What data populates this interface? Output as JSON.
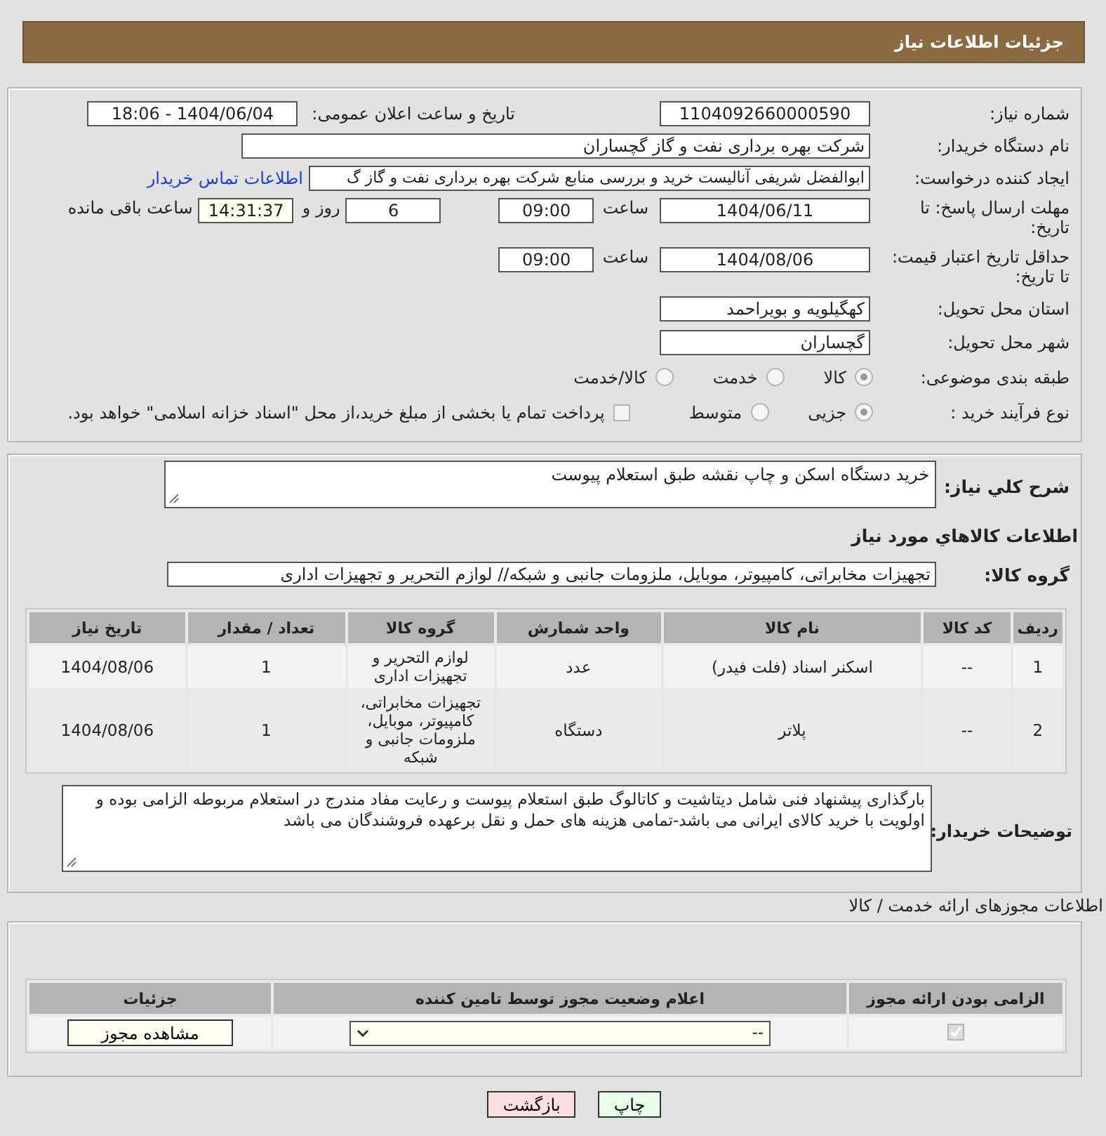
{
  "header": {
    "title": "جزئیات اطلاعات نیاز"
  },
  "details": {
    "need_number": {
      "label": "شماره نیاز:",
      "value": "1104092660000590"
    },
    "announce": {
      "label": "تاریخ و ساعت اعلان عمومی:",
      "value": "1404/06/04 - 18:06"
    },
    "buyer": {
      "label": "نام دستگاه خریدار:",
      "value": "شرکت بهره برداری نفت و گاز گچساران"
    },
    "creator": {
      "label": "ایجاد کننده درخواست:",
      "value": "ابوالفضل شریفی آنالیست خرید و بررسی منابع شرکت بهره برداری نفت و گاز گ",
      "link": "اطلاعات تماس خریدار"
    },
    "deadline": {
      "label": "مهلت ارسال پاسخ: تا تاریخ:",
      "date": "1404/06/11",
      "time_label": "ساعت",
      "time": "09:00",
      "days": "6",
      "days_label": "روز و",
      "remaining": "14:31:37",
      "remaining_label": "ساعت باقی مانده"
    },
    "validity": {
      "label": "حداقل تاریخ اعتبار قیمت: تا تاریخ:",
      "date": "1404/08/06",
      "time_label": "ساعت",
      "time": "09:00"
    },
    "province": {
      "label": "استان محل تحویل:",
      "value": "کهگیلویه و بویراحمد"
    },
    "city": {
      "label": "شهر محل تحویل:",
      "value": "گچساران"
    },
    "category": {
      "label": "طبقه بندی موضوعی:",
      "options": [
        {
          "label": "کالا",
          "selected": true
        },
        {
          "label": "خدمت",
          "selected": false
        },
        {
          "label": "کالا/خدمت",
          "selected": false
        }
      ]
    },
    "process": {
      "label": "نوع فرآیند خرید :",
      "options": [
        {
          "label": "جزیی",
          "selected": true
        },
        {
          "label": "متوسط",
          "selected": false
        }
      ],
      "treasury": {
        "label": "پرداخت تمام یا بخشی از مبلغ خرید،از محل \"اسناد خزانه اسلامی\" خواهد بود.",
        "checked": false
      }
    }
  },
  "needs": {
    "summary_label": "شرح کلي نياز:",
    "summary": "خرید دستگاه اسکن و چاپ نقشه طبق استعلام پیوست",
    "goods_heading": "اطلاعات کالاهاي مورد نياز",
    "group_label": "گروه کالا:",
    "group": "تجهیزات مخابراتی، کامپیوتر، موبایل، ملزومات جانبی و شبکه// لوازم التحریر و تجهیزات اداری",
    "table": {
      "columns": [
        "ردیف",
        "کد کالا",
        "نام کالا",
        "واحد شمارش",
        "گروه کالا",
        "تعداد / مقدار",
        "تاریخ نیاز"
      ],
      "rows": [
        [
          "1",
          "--",
          "اسکنر اسناد (فلت فیدر)",
          "عدد",
          "لوازم التحریر و تجهیزات اداری",
          "1",
          "1404/08/06"
        ],
        [
          "2",
          "--",
          "پلاتر",
          "دستگاه",
          "تجهیزات مخابراتی، کامپیوتر، موبایل، ملزومات جانبی و شبکه",
          "1",
          "1404/08/06"
        ]
      ]
    },
    "notes_label": "توضیحات خریدار:",
    "notes": "بارگذاری پیشنهاد فنی شامل دیتاشیت و کاتالوگ طبق استعلام پیوست و رعایت مفاد مندرج در استعلام مربوطه الزامی بوده و اولویت با خرید کالای ایرانی می باشد-تمامی هزینه های حمل و نقل برعهده فروشندگان می باشد"
  },
  "permits": {
    "heading": "اطلاعات مجوزهای ارائه خدمت / کالا",
    "columns": [
      "الزامی بودن ارائه مجوز",
      "اعلام وضعیت مجوز توسط تامین کننده",
      "جزئیات"
    ],
    "rows": [
      {
        "required": true,
        "status": "--",
        "action": "مشاهده مجوز"
      }
    ]
  },
  "buttons": [
    {
      "label": "چاپ",
      "kind": "print"
    },
    {
      "label": "بازگشت",
      "kind": "back"
    }
  ]
}
